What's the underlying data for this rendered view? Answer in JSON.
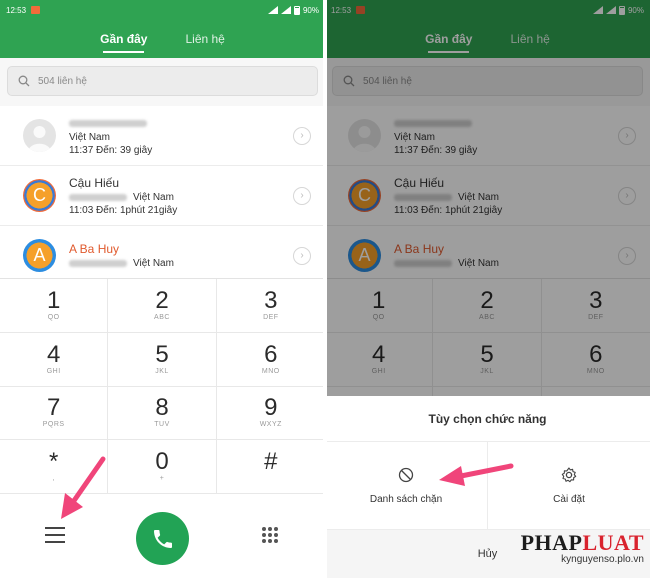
{
  "status": {
    "time": "12:53",
    "battery": "90%"
  },
  "tabs": {
    "recent": "Gần đây",
    "contacts": "Liên hệ"
  },
  "search": {
    "placeholder": "504 liên hệ"
  },
  "contacts": [
    {
      "name": "",
      "location": "Việt Nam",
      "call": "11:37 Đến: 39 giây",
      "avatar": "person-avatar"
    },
    {
      "name": "Cậu Hiếu",
      "location": "Việt Nam",
      "call": "11:03 Đến: 1phút 21giây",
      "avatar_letter": "C"
    },
    {
      "name": "A Ba Huy",
      "location": "Việt Nam",
      "call": "",
      "avatar_letter": "A"
    }
  ],
  "dialpad": [
    {
      "digit": "1",
      "letters": "QO"
    },
    {
      "digit": "2",
      "letters": "ABC"
    },
    {
      "digit": "3",
      "letters": "DEF"
    },
    {
      "digit": "4",
      "letters": "GHI"
    },
    {
      "digit": "5",
      "letters": "JKL"
    },
    {
      "digit": "6",
      "letters": "MNO"
    },
    {
      "digit": "7",
      "letters": "PQRS"
    },
    {
      "digit": "8",
      "letters": "TUV"
    },
    {
      "digit": "9",
      "letters": "WXYZ"
    },
    {
      "digit": "*",
      "letters": ","
    },
    {
      "digit": "0",
      "letters": "+"
    },
    {
      "digit": "#",
      "letters": ""
    }
  ],
  "sheet": {
    "title": "Tùy chọn chức năng",
    "block_list": "Danh sách chặn",
    "settings": "Cài đặt",
    "cancel": "Hủy"
  },
  "watermark": {
    "logo_a": "PHAP",
    "logo_b": "LUAT",
    "site": "kynguyenso.plo.vn"
  },
  "colors": {
    "accent": "#2fa352",
    "call_button": "#22a355",
    "arrow": "#f0457a",
    "highlight_name": "#e05a2e"
  }
}
